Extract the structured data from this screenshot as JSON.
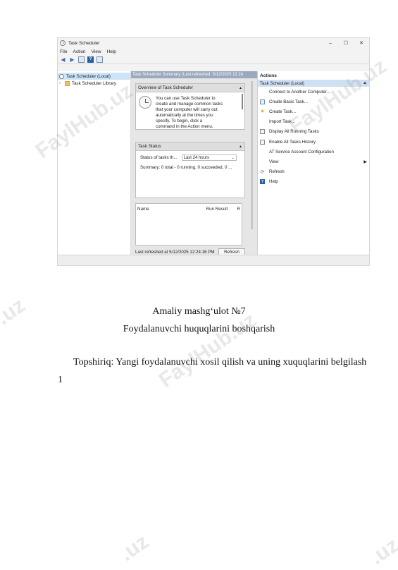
{
  "window": {
    "title": "Task Scheduler",
    "controls": [
      "–",
      "☐",
      "✕"
    ],
    "menu": [
      "File",
      "Action",
      "View",
      "Help"
    ]
  },
  "tree": {
    "items": [
      "Task Scheduler (Local)",
      "Task Scheduler Library"
    ]
  },
  "center": {
    "header": "Task Scheduler Summary (Last refreshed: 5/12/2025 12:24",
    "overview": {
      "title": "Overview of Task Scheduler",
      "lines": [
        "You can use Task Scheduler to",
        "create and manage common tasks",
        "that your computer will carry out",
        "automatically at the times you",
        "specify. To begin, click a",
        "command in the Action menu."
      ]
    },
    "task_status": {
      "title": "Task Status",
      "label": "Status of tasks th...",
      "dropdown_value": "Last 24 hours",
      "summary": "Summary: 0 total - 0 running, 0 succeeded, 0 ..."
    },
    "grid": {
      "columns": [
        "Name",
        "Run Result",
        "R"
      ]
    },
    "footer": {
      "last_refreshed": "Last refreshed at 5/12/2025 12:24:16 PM",
      "refresh_label": "Refresh"
    }
  },
  "actions": {
    "title": "Actions",
    "subheader": "Task Scheduler (Local)",
    "items": [
      {
        "label": "Connect to Another Computer...",
        "icon": "blank-icon"
      },
      {
        "label": "Create Basic Task...",
        "icon": "create-basic-task-icon"
      },
      {
        "label": "Create Task...",
        "icon": "create-task-icon"
      },
      {
        "label": "Import Task...",
        "icon": "blank-icon"
      },
      {
        "label": "Display All Running Tasks",
        "icon": "running-tasks-icon"
      },
      {
        "label": "Enable All Tasks History",
        "icon": "history-icon"
      },
      {
        "label": "AT Service Account Configuration",
        "icon": "blank-icon"
      },
      {
        "label": "View",
        "icon": "blank-icon"
      },
      {
        "label": "Refresh",
        "icon": "refresh-icon"
      },
      {
        "label": "Help",
        "icon": "help-icon"
      }
    ]
  },
  "document": {
    "title": "Amaliy mashg‘ulot №7",
    "subtitle": "Foydalanuvchi huquqlarini boshqarish",
    "task": "Topshiriq: Yangi foydalanuvchi xosil qilish va uning xuquqlarini belgilash",
    "page_number": "1"
  },
  "watermark": {
    "text": "FaylHub.uz",
    "fragment": ".uz",
    "color": "#969696"
  }
}
